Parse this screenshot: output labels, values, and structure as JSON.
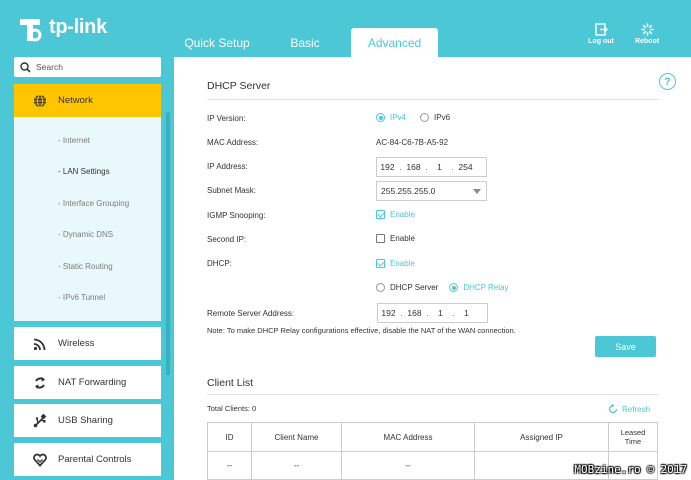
{
  "header": {
    "brand": "tp-link",
    "tabs": [
      {
        "label": "Quick Setup",
        "active": false
      },
      {
        "label": "Basic",
        "active": false
      },
      {
        "label": "Advanced",
        "active": true
      }
    ],
    "logout_label": "Log out",
    "reboot_label": "Reboot"
  },
  "sidebar": {
    "search_placeholder": "Search",
    "network_label": "Network",
    "sub_items": [
      "- Internet",
      "- LAN Settings",
      "- Interface Grouping",
      "- Dynamic DNS",
      "- Static Routing",
      "- IPv6 Tunnel"
    ],
    "active_sub": "- LAN Settings",
    "wireless_label": "Wireless",
    "nat_label": "NAT Forwarding",
    "usb_label": "USB Sharing",
    "parental_label": "Parental Controls"
  },
  "dhcp_server": {
    "title": "DHCP Server",
    "ip_version_label": "IP Version:",
    "ipv4_label": "IPv4",
    "ipv6_label": "IPv6",
    "ip_version_selected": "IPv4",
    "mac_label": "MAC Address:",
    "mac_value": "AC-84-C6-7B-A5-92",
    "ip_label": "IP Address:",
    "ip_octets": [
      "192",
      "168",
      "1",
      "254"
    ],
    "mask_label": "Subnet Mask:",
    "mask_value": "255.255.255.0",
    "igmp_label": "IGMP Snooping:",
    "igmp_enable_label": "Enable",
    "igmp_checked": true,
    "second_ip_label": "Second IP:",
    "second_ip_enable_label": "Enable",
    "second_ip_checked": false,
    "dhcp_label": "DHCP:",
    "dhcp_enable_label": "Enable",
    "dhcp_checked": true,
    "dhcp_server_option": "DHCP Server",
    "dhcp_relay_option": "DHCP Relay",
    "dhcp_mode_selected": "DHCP Relay",
    "remote_label": "Remote Server Address:",
    "remote_octets": [
      "192",
      "168",
      "1",
      "1"
    ],
    "note": "Note: To make DHCP Relay configurations effective, disable the NAT of the WAN connection.",
    "save_label": "Save"
  },
  "client_list": {
    "title": "Client List",
    "total_label": "Total Clients: 0",
    "refresh_label": "Refresh",
    "columns": [
      "ID",
      "Client Name",
      "MAC Address",
      "Assigned IP",
      "Leased Time"
    ],
    "row": [
      "--",
      "--",
      "--",
      "",
      ""
    ]
  },
  "watermark": "MOBzine.ro © 2017",
  "colors": {
    "accent": "#4bc7d6",
    "active_nav": "#ffc600"
  }
}
